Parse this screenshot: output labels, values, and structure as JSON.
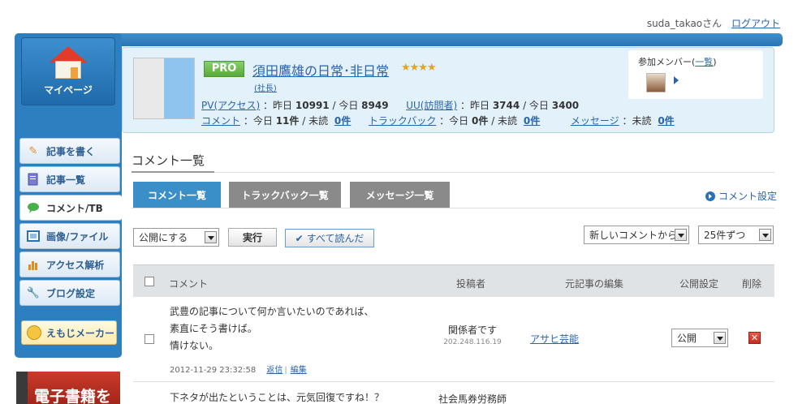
{
  "header": {
    "user": "suda_takaoさん",
    "logout": "ログアウト"
  },
  "sidebar": {
    "mypage": "マイページ",
    "items": [
      {
        "label": "記事を書く",
        "icon": "pencil-icon"
      },
      {
        "label": "記事一覧",
        "icon": "document-icon"
      },
      {
        "label": "コメント/TB",
        "icon": "speech-bubble-icon"
      },
      {
        "label": "画像/ファイル",
        "icon": "image-icon"
      },
      {
        "label": "アクセス解析",
        "icon": "bar-chart-icon"
      },
      {
        "label": "ブログ設定",
        "icon": "wrench-icon"
      }
    ],
    "emoji_maker": "えもじメーカー",
    "ebook": "電子書籍を"
  },
  "profile": {
    "badge": "PRO",
    "blog_title": "須田鷹雄の日常･非日常",
    "stars": "★★★★",
    "role": "(社長)",
    "pv_label": "PV(アクセス)",
    "pv_text": "：昨日",
    "pv_yesterday": "10991",
    "pv_sep": "/ 今日",
    "pv_today": "8949",
    "uu_label": "UU(訪問者)",
    "uu_text": "：昨日",
    "uu_yesterday": "3744",
    "uu_sep": "/ 今日",
    "uu_today": "3400",
    "comment_label": "コメント",
    "comment_today_text": "：今日",
    "comment_today": "11件",
    "comment_unread_text": "/ 未読",
    "comment_unread": "0件",
    "trackback_label": "トラックバック",
    "tb_today_text": "：今日",
    "tb_today": "0件",
    "tb_unread_text": "/ 未読",
    "tb_unread": "0件",
    "message_label": "メッセージ",
    "msg_unread_text": "：未読",
    "msg_unread": "0件",
    "members_title": "参加メンバー(",
    "members_link": "一覧",
    "members_close": ")"
  },
  "section": {
    "title": "コメント一覧"
  },
  "tabs": [
    {
      "label": "コメント一覧",
      "active": true
    },
    {
      "label": "トラックバック一覧",
      "active": false
    },
    {
      "label": "メッセージ一覧",
      "active": false
    }
  ],
  "comment_setting": "コメント設定",
  "controls": {
    "action_select": "公開にする",
    "execute": "実行",
    "mark_all_read": "すべて読んだ",
    "sort_select": "新しいコメントから",
    "per_page_select": "25件ずつ"
  },
  "table": {
    "headers": {
      "comment": "コメント",
      "poster": "投稿者",
      "article": "元記事の編集",
      "publish": "公開設定",
      "delete": "削除"
    },
    "rows": [
      {
        "lines": [
          "武豊の記事について何か言いたいのであれば、",
          "素直にそう書けば。",
          "情けない。"
        ],
        "date": "2012-11-29 23:32:58",
        "reply": "返信",
        "edit": "編集",
        "poster": "関係者です",
        "ip": "202.248.116.19",
        "article": "アサヒ芸能",
        "publish": "公開",
        "delete": "✕"
      },
      {
        "lines": [
          "下ネタが出たということは、元気回復ですね！？"
        ],
        "poster": "社会馬券労務師"
      }
    ]
  }
}
